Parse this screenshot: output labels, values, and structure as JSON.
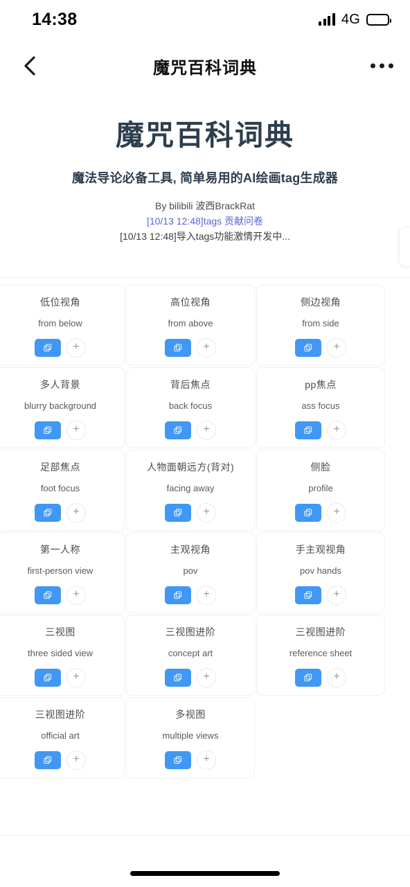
{
  "status_bar": {
    "time": "14:38",
    "network": "4G",
    "signal_icon": "signal-bars-icon",
    "battery_icon": "battery-icon"
  },
  "nav": {
    "back_icon": "chevron-left-icon",
    "title": "魔咒百科词典",
    "more_icon": "ellipsis-icon"
  },
  "header": {
    "title": "魔咒百科词典",
    "subtitle": "魔法导论必备工具, 简单易用的AI绘画tag生成器",
    "byline": "By bilibili 波西BrackRat",
    "notice_link": "[10/13 12:48]tags 贡献问卷",
    "notice_plain": "[10/13 12:48]导入tags功能激情开发中..."
  },
  "colors": {
    "accent_blue": "#4098f4",
    "title_navy": "#2e3e4e",
    "link_purple": "#5a63d8",
    "card_border": "#f0f0f0"
  },
  "card_actions": {
    "copy_icon": "copy-icon",
    "add_label": "+"
  },
  "cards": [
    {
      "cn": "低位视角",
      "en": "from below"
    },
    {
      "cn": "高位视角",
      "en": "from above"
    },
    {
      "cn": "侧边视角",
      "en": "from side"
    },
    {
      "cn": "多人背景",
      "en": "blurry background"
    },
    {
      "cn": "背后焦点",
      "en": "back focus"
    },
    {
      "cn": "pp焦点",
      "en": "ass focus"
    },
    {
      "cn": "足部焦点",
      "en": "foot focus"
    },
    {
      "cn": "人物面朝远方(背对)",
      "en": "facing away"
    },
    {
      "cn": "侧脸",
      "en": "profile"
    },
    {
      "cn": "第一人称",
      "en": "first-person view"
    },
    {
      "cn": "主观视角",
      "en": "pov"
    },
    {
      "cn": "手主观视角",
      "en": "pov hands"
    },
    {
      "cn": "三视图",
      "en": "three sided view"
    },
    {
      "cn": "三视图进阶",
      "en": "concept art"
    },
    {
      "cn": "三视图进阶",
      "en": "reference sheet"
    },
    {
      "cn": "三视图进阶",
      "en": "official art"
    },
    {
      "cn": "多视图",
      "en": "multiple views"
    }
  ]
}
